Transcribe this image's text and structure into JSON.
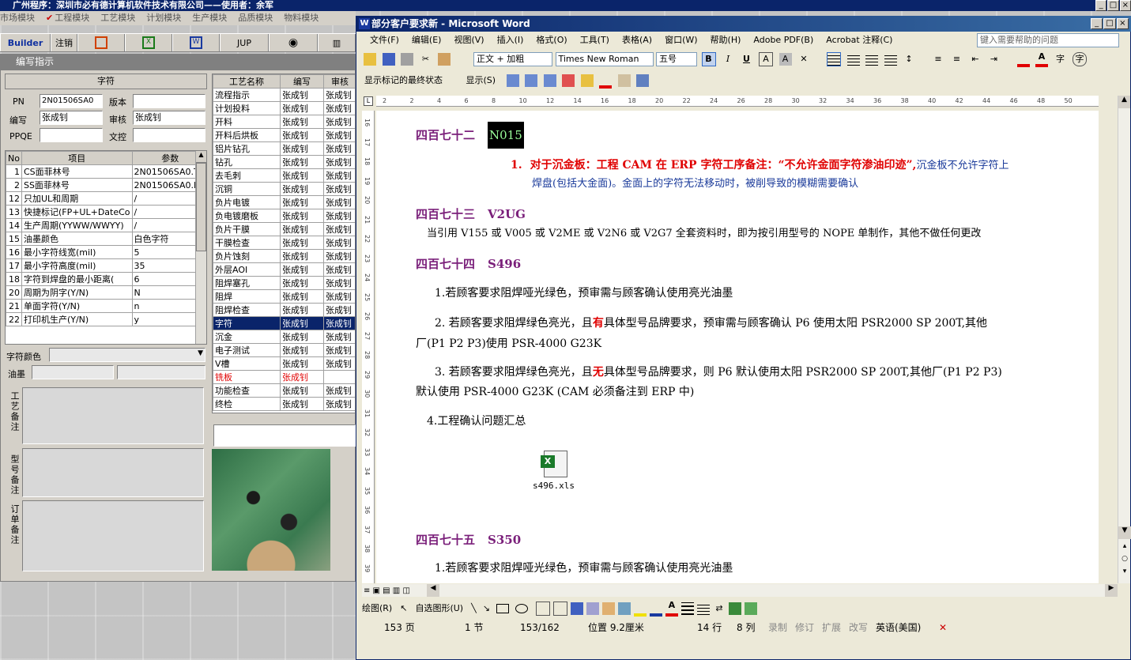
{
  "app": {
    "title": "广州程序：深圳市必有德计算机软件技术有限公司——使用者：余军",
    "menu": [
      "市场模块",
      "工程模块",
      "工艺模块",
      "计划模块",
      "生产模块",
      "品质模块",
      "物料模块"
    ],
    "toolbar": [
      "Builder",
      "注销",
      "JUP"
    ],
    "window_title": "编写指示",
    "section_title": "字符",
    "form": {
      "pn_label": "PN",
      "pn_value": "2N01506SA0",
      "version_label": "版本",
      "version_value": "",
      "writer_label": "编写",
      "writer_value": "张成钊",
      "reviewer_label": "审核",
      "reviewer_value": "张成钊",
      "ppqe_label": "PPQE",
      "ppqe_value": "",
      "doc_label": "文控",
      "doc_value": ""
    },
    "param_table": {
      "headers": [
        "No",
        "项目",
        "参数"
      ],
      "rows": [
        [
          "1",
          "CS面菲林号",
          "2N01506SA0.TO"
        ],
        [
          "2",
          "SS面菲林号",
          "2N01506SA0.BO"
        ],
        [
          "12",
          "只加UL和周期",
          "/"
        ],
        [
          "13",
          "快捷标记(FP+UL+DateCo",
          "/"
        ],
        [
          "14",
          "生产周期(YYWW/WWYY)",
          "/"
        ],
        [
          "15",
          "油墨颜色",
          "白色字符"
        ],
        [
          "16",
          "最小字符线宽(mil)",
          "5"
        ],
        [
          "17",
          "最小字符高度(mil)",
          "35"
        ],
        [
          "18",
          "字符到焊盘的最小距离(",
          "6"
        ],
        [
          "20",
          "周期为阴字(Y/N)",
          "N"
        ],
        [
          "21",
          "单面字符(Y/N)",
          "n"
        ],
        [
          "22",
          "打印机生产(Y/N)",
          "y"
        ]
      ]
    },
    "char_color_label": "字符颜色",
    "ink_label": "油墨",
    "remarks": [
      "工艺备注",
      "型号备注",
      "订单备注"
    ],
    "process_table": {
      "headers": [
        "工艺名称",
        "编写",
        "审核"
      ],
      "rows": [
        [
          "流程指示",
          "张成钊",
          "张成钊"
        ],
        [
          "计划投料",
          "张成钊",
          "张成钊"
        ],
        [
          "开料",
          "张成钊",
          "张成钊"
        ],
        [
          "开料后烘板",
          "张成钊",
          "张成钊"
        ],
        [
          "铝片钻孔",
          "张成钊",
          "张成钊"
        ],
        [
          "钻孔",
          "张成钊",
          "张成钊"
        ],
        [
          "去毛刺",
          "张成钊",
          "张成钊"
        ],
        [
          "沉铜",
          "张成钊",
          "张成钊"
        ],
        [
          "负片电镀",
          "张成钊",
          "张成钊"
        ],
        [
          "负电镀磨板",
          "张成钊",
          "张成钊"
        ],
        [
          "负片干膜",
          "张成钊",
          "张成钊"
        ],
        [
          "干膜检查",
          "张成钊",
          "张成钊"
        ],
        [
          "负片蚀刻",
          "张成钊",
          "张成钊"
        ],
        [
          "外层AOI",
          "张成钊",
          "张成钊"
        ],
        [
          "阻焊塞孔",
          "张成钊",
          "张成钊"
        ],
        [
          "阻焊",
          "张成钊",
          "张成钊"
        ],
        [
          "阻焊检查",
          "张成钊",
          "张成钊"
        ],
        [
          "字符",
          "张成钊",
          "张成钊"
        ],
        [
          "沉金",
          "张成钊",
          "张成钊"
        ],
        [
          "电子测试",
          "张成钊",
          "张成钊"
        ],
        [
          "V槽",
          "张成钊",
          "张成钊"
        ],
        [
          "铣板",
          "张成钊",
          ""
        ],
        [
          "功能检查",
          "张成钊",
          "张成钊"
        ],
        [
          "终检",
          "张成钊",
          "张成钊"
        ]
      ],
      "selected_index": 17,
      "red_index": 21
    }
  },
  "word": {
    "title": "部分客户要求新 - Microsoft Word",
    "menu": [
      "文件(F)",
      "编辑(E)",
      "视图(V)",
      "插入(I)",
      "格式(O)",
      "工具(T)",
      "表格(A)",
      "窗口(W)",
      "帮助(H)",
      "Adobe PDF(B)",
      "Acrobat 注释(C)"
    ],
    "help_placeholder": "键入需要帮助的问题",
    "style": "正文 + 加粗",
    "font": "Times New Roman",
    "size": "五号",
    "markup_view": "显示标记的最终状态",
    "show_label": "显示(S)",
    "ruler_marks": [
      "2",
      "2",
      "4",
      "6",
      "8",
      "10",
      "12",
      "14",
      "16",
      "18",
      "20",
      "22",
      "24",
      "26",
      "28",
      "30",
      "32",
      "34",
      "36",
      "38",
      "40",
      "42",
      "44",
      "46",
      "48",
      "50"
    ],
    "ruler_vert": [
      "16",
      "17",
      "18",
      "19",
      "20",
      "21",
      "22",
      "23",
      "24",
      "25",
      "26",
      "27",
      "28",
      "29",
      "30",
      "31",
      "32",
      "33",
      "34",
      "35",
      "36",
      "37",
      "38",
      "39"
    ],
    "doc": {
      "h472": "四百七十二",
      "h472_code": "N015",
      "p472_num": "1.",
      "p472_red": "对于沉金板：工程 CAM 在 ERP 字符工序备注：“不允许金面字符渗油印迹”,",
      "p472_blue1": "沉金板不允许字符上",
      "p472_blue2": "焊盘(包括大金面)。金面上的字符无法移动时，被削导致的模糊需要确认",
      "h473": "四百七十三",
      "h473_code": "V2UG",
      "p473": "当引用 V155 或 V005 或 V2ME 或 V2N6 或 V2G7 全套资料时，即为按引用型号的 NOPE 单制作，其他不做任何更改",
      "h474": "四百七十四",
      "h474_code": "S496",
      "p474_1": "1.若顾客要求阻焊哑光绿色，预审需与顾客确认使用亮光油墨",
      "p474_2a": "2. 若顾客要求阻焊绿色亮光，且",
      "p474_2b": "有",
      "p474_2c": "具体型号品牌要求，预审需与顾客确认 P6 使用太阳 PSR2000  SP 200T,其他",
      "p474_2d": "厂(P1 P2 P3)使用 PSR-4000 G23K",
      "p474_3a": "3. 若顾客要求阻焊绿色亮光，且",
      "p474_3b": "无",
      "p474_3c": "具体型号品牌要求，则 P6 默认使用太阳 PSR2000 SP 200T,其他厂(P1 P2 P3)",
      "p474_3d": "默认使用 PSR-4000 G23K    (CAM 必须备注到 ERP 中)",
      "p474_4": "4.工程确认问题汇总",
      "attachment": "s496.xls",
      "h475": "四百七十五",
      "h475_code": "S350",
      "p475_1": "1.若顾客要求阻焊哑光绿色，预审需与顾客确认使用亮光油墨"
    },
    "draw_label": "绘图(R)",
    "autoshape_label": "自选图形(U)",
    "status": {
      "page": "153 页",
      "section": "1 节",
      "pages": "153/162",
      "position": "位置 9.2厘米",
      "line": "14 行",
      "col": "8 列",
      "rec": "录制",
      "trk": "修订",
      "ext": "扩展",
      "ovr": "改写",
      "lang": "英语(美国)"
    }
  },
  "colors": {
    "title_blue": "#0a246a",
    "heading_purple": "#7a1f7a",
    "red": "#e00000",
    "blue_text": "#1a3a9a",
    "selected_row": "#0a246a"
  }
}
